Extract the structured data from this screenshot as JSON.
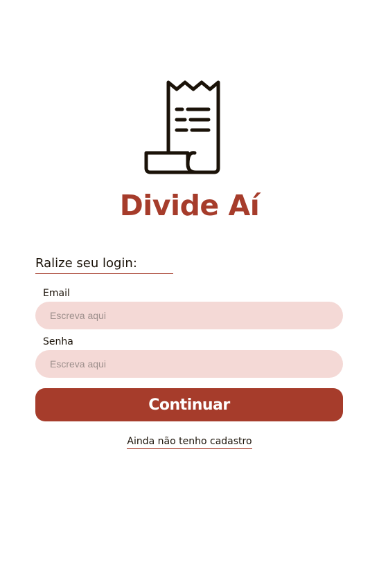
{
  "brand": {
    "logo_icon": "receipt-icon",
    "title": "Divide Aí",
    "accent_color": "#a63c2b",
    "input_background": "#f4d9d6",
    "text_color": "#1a1208"
  },
  "login": {
    "heading": "Ralize seu login:",
    "email_label": "Email",
    "email_placeholder": "Escreva aqui",
    "email_value": "",
    "password_label": "Senha",
    "password_placeholder": "Escreva aqui",
    "password_value": "",
    "submit_label": "Continuar",
    "register_link": "Ainda não tenho cadastro"
  }
}
